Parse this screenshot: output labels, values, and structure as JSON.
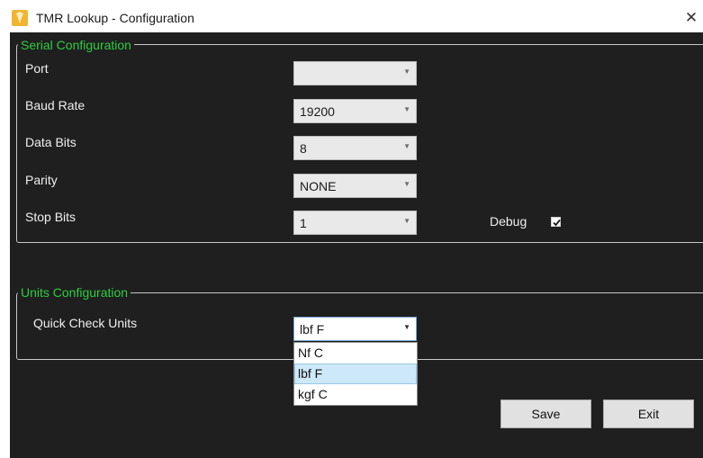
{
  "window": {
    "title": "TMR Lookup - Configuration",
    "close_glyph": "✕",
    "icon": "app-icon"
  },
  "serial": {
    "title": "Serial Configuration",
    "port": {
      "label": "Port",
      "value": ""
    },
    "baud_rate": {
      "label": "Baud Rate",
      "value": "19200"
    },
    "data_bits": {
      "label": "Data Bits",
      "value": "8"
    },
    "parity": {
      "label": "Parity",
      "value": "NONE"
    },
    "stop_bits": {
      "label": "Stop Bits",
      "value": "1"
    },
    "debug": {
      "label": "Debug",
      "checked": true
    }
  },
  "units": {
    "title": "Units Configuration",
    "quick_check": {
      "label": "Quick Check Units",
      "value": "lbf F",
      "options": [
        "Nf C",
        "lbf F",
        "kgf C"
      ],
      "highlighted_index": 1
    }
  },
  "buttons": {
    "save": "Save",
    "exit": "Exit"
  },
  "colors": {
    "background": "#1f1f1f",
    "group_title": "#2ecc40",
    "label": "#f0f0f0",
    "highlight": "#cde8f8"
  }
}
